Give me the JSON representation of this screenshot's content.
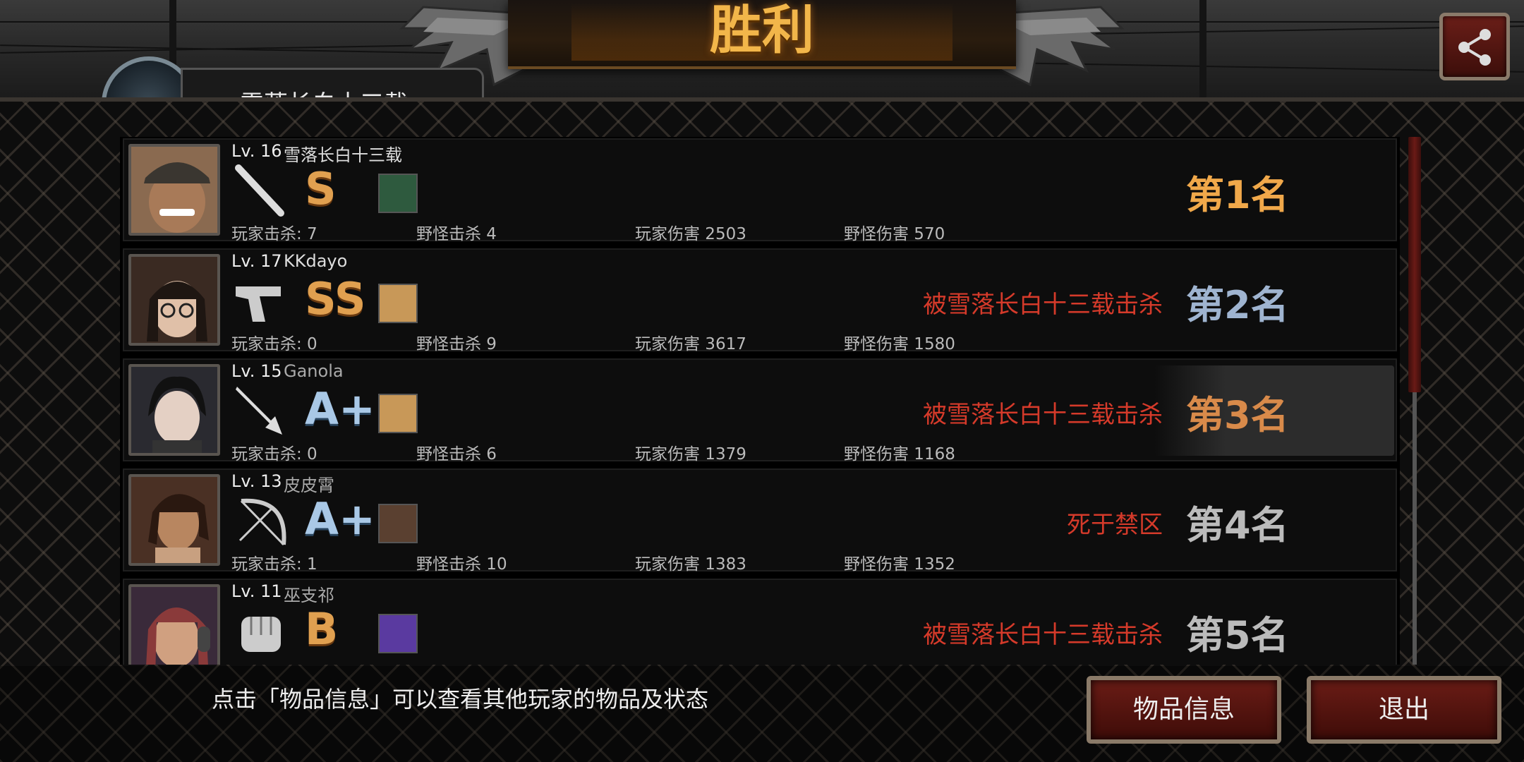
{
  "title": "胜利",
  "me": {
    "name": "雪落长白十三载"
  },
  "players": [
    {
      "level": "Lv. 16",
      "name": "雪落长白十三载",
      "name_color": "#eeeeee",
      "weapon": "bat-icon",
      "grade": "S",
      "grade_style": "orange",
      "item_color": "#3a6a4a",
      "kills_label": "玩家击杀: 7",
      "monster_kills": "野怪击杀 4",
      "player_damage": "玩家伤害 2503",
      "monster_damage": "野怪伤害 570",
      "status": "",
      "rank": "第1名",
      "rank_color": "#f0a84a"
    },
    {
      "level": "Lv. 17",
      "name": "KKdayo",
      "name_color": "#eeeeee",
      "weapon": "pistol-icon",
      "grade": "SS",
      "grade_style": "orange",
      "item_color": "#c89858",
      "kills_label": "玩家击杀: 0",
      "monster_kills": "野怪击杀 9",
      "player_damage": "玩家伤害 3617",
      "monster_damage": "野怪伤害 1580",
      "status": "被雪落长白十三载击杀",
      "rank": "第2名",
      "rank_color": "#9fb4d0"
    },
    {
      "level": "Lv. 15",
      "name": "Ganola",
      "name_color": "#aaaaaa",
      "weapon": "knife-icon",
      "grade": "A+",
      "grade_style": "blue",
      "item_color": "#c89858",
      "kills_label": "玩家击杀: 0",
      "monster_kills": "野怪击杀 6",
      "player_damage": "玩家伤害 1379",
      "monster_damage": "野怪伤害 1168",
      "status": "被雪落长白十三载击杀",
      "rank": "第3名",
      "rank_color": "#d88a4a"
    },
    {
      "level": "Lv. 13",
      "name": "皮皮霄",
      "name_color": "#aaaaaa",
      "weapon": "bow-icon",
      "grade": "A+",
      "grade_style": "blue",
      "item_color": "#5a4030",
      "kills_label": "玩家击杀: 1",
      "monster_kills": "野怪击杀 10",
      "player_damage": "玩家伤害 1383",
      "monster_damage": "野怪伤害 1352",
      "status": "死于禁区",
      "rank": "第4名",
      "rank_color": "#bbbbbb"
    },
    {
      "level": "Lv. 11",
      "name": "巫支祁",
      "name_color": "#aaaaaa",
      "weapon": "fist-icon",
      "grade": "B",
      "grade_style": "orange",
      "item_color": "#5a3aa0",
      "kills_label": "",
      "monster_kills": "",
      "player_damage": "",
      "monster_damage": "",
      "status": "被雪落长白十三载击杀",
      "rank": "第5名",
      "rank_color": "#bbbbbb"
    }
  ],
  "hint": "点击「物品信息」可以查看其他玩家的物品及状态",
  "buttons": {
    "items": "物品信息",
    "exit": "退出"
  },
  "icons": {
    "share": "share-icon"
  }
}
